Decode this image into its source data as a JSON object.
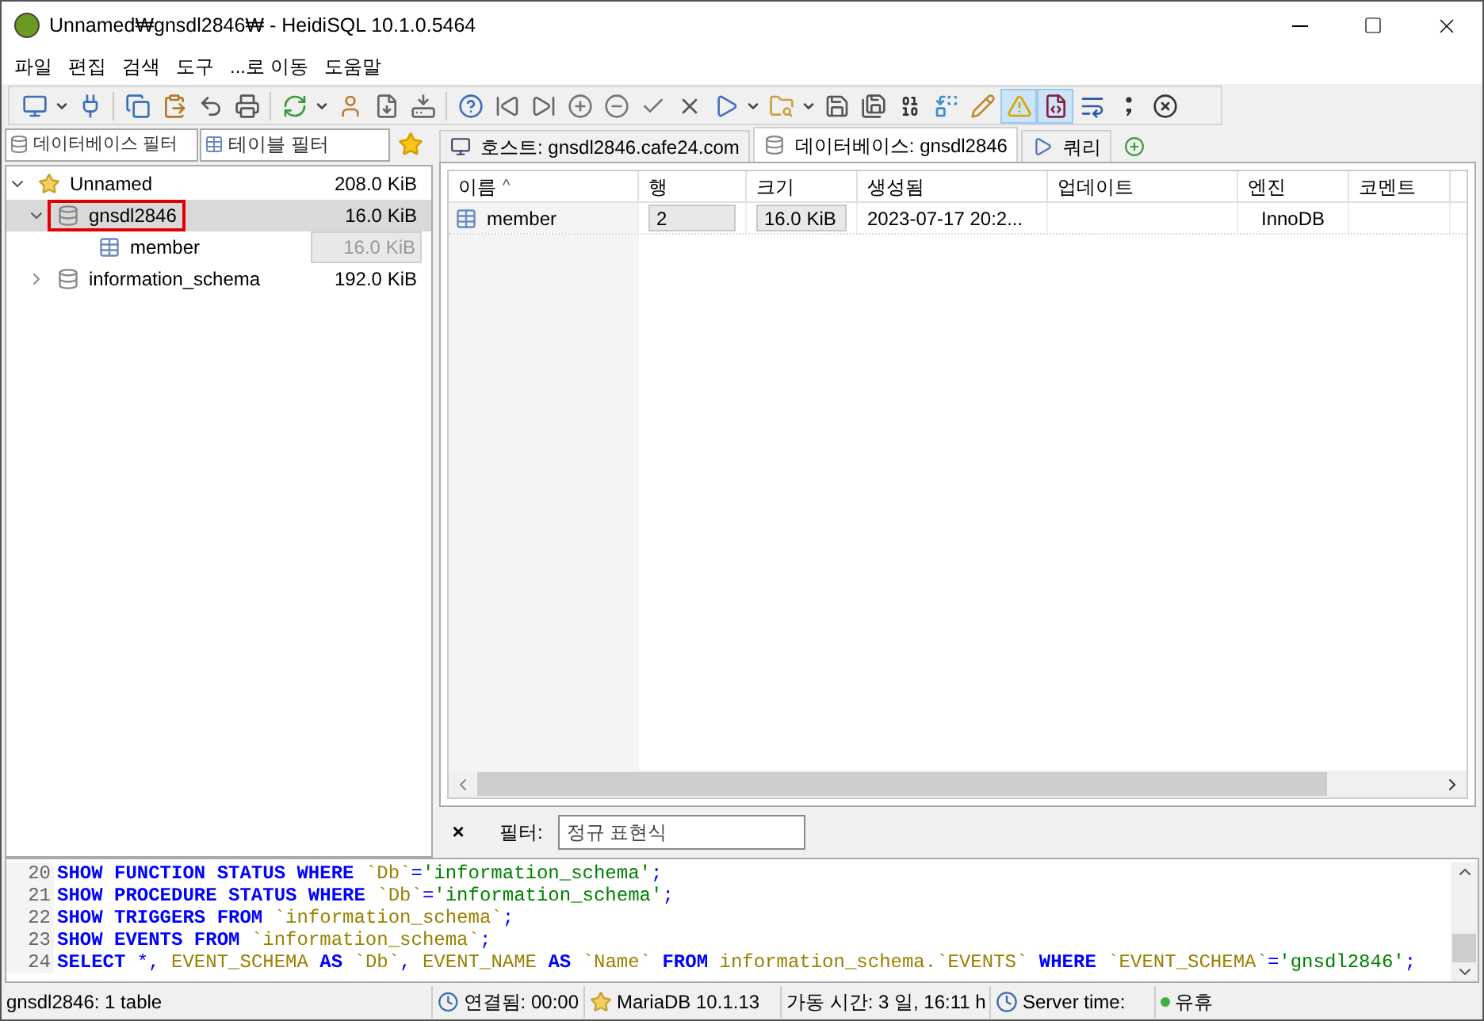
{
  "window": {
    "title": "Unnamed₩gnsdl2846₩ - HeidiSQL 10.1.0.5464"
  },
  "menu": [
    "파일",
    "편집",
    "검색",
    "도구",
    "...로 이동",
    "도움말"
  ],
  "toolbar": [
    {
      "pressed": false
    },
    {
      "pressed": false
    },
    {
      "pressed": false
    },
    {
      "pressed": false
    },
    {
      "pressed": false
    },
    {
      "pressed": false
    },
    {
      "pressed": false
    },
    {
      "pressed": false
    },
    {
      "pressed": false
    },
    {
      "pressed": false
    },
    {
      "pressed": false
    },
    {
      "pressed": false
    },
    {
      "pressed": false
    },
    {
      "pressed": false
    },
    {
      "pressed": false
    },
    {
      "pressed": false
    },
    {
      "pressed": false
    },
    {
      "pressed": false
    },
    {
      "pressed": false
    },
    {
      "pressed": false
    },
    {
      "pressed": false
    },
    {
      "pressed": false
    },
    {
      "pressed": false
    },
    {
      "pressed": false
    },
    {
      "pressed": false
    },
    {
      "pressed": false
    },
    {
      "pressed": false
    },
    {
      "pressed": false
    },
    {
      "pressed": true
    },
    {
      "pressed": true
    },
    {
      "pressed": false
    },
    {
      "pressed": false
    },
    {
      "pressed": false
    }
  ],
  "sidebar": {
    "db_filter": {
      "placeholder": "데이터베이스 필터"
    },
    "table_filter": {
      "placeholder": "테이블 필터"
    },
    "tree": [
      {
        "label": "Unnamed",
        "size": "208.0 KiB",
        "kind": "server",
        "expanded": true,
        "selected": false,
        "annotated": false,
        "children": [
          {
            "label": "gnsdl2846",
            "size": "16.0 KiB",
            "kind": "database",
            "expanded": true,
            "selected": true,
            "annotated": true,
            "children": [
              {
                "label": "member",
                "size": "16.0 KiB",
                "kind": "table",
                "selected": false,
                "annotated": false
              }
            ]
          },
          {
            "label": "information_schema",
            "size": "192.0 KiB",
            "kind": "database",
            "expanded": false,
            "selected": false,
            "annotated": false
          }
        ]
      }
    ]
  },
  "tabs": [
    {
      "label": "호스트: gnsdl2846.cafe24.com",
      "kind": "host",
      "selected": false
    },
    {
      "label": "데이터베이스: gnsdl2846",
      "kind": "database",
      "selected": true
    },
    {
      "label": "쿼리",
      "kind": "query",
      "selected": false
    }
  ],
  "table": {
    "columns": [
      "이름",
      "행",
      "크기",
      "생성됨",
      "업데이트",
      "엔진",
      "코멘트"
    ],
    "sort_mark": "^",
    "rows": [
      [
        "member",
        "2",
        "16.0 KiB",
        "2023-07-17 20:2...",
        "",
        "InnoDB",
        ""
      ]
    ]
  },
  "filter": {
    "close": "×",
    "label": "필터:",
    "placeholder": "정규 표현식"
  },
  "sql_log": [
    {
      "number": "20",
      "tokens": [
        {
          "text": "SHOW FUNCTION STATUS WHERE ",
          "kind": "keyword"
        },
        {
          "text": "`Db`",
          "kind": "identifier"
        },
        {
          "text": "=",
          "kind": "symbol"
        },
        {
          "text": "'information_schema'",
          "kind": "string"
        },
        {
          "text": ";",
          "kind": "symbol"
        }
      ]
    },
    {
      "number": "21",
      "tokens": [
        {
          "text": "SHOW PROCEDURE STATUS WHERE ",
          "kind": "keyword"
        },
        {
          "text": "`Db`",
          "kind": "identifier"
        },
        {
          "text": "=",
          "kind": "symbol"
        },
        {
          "text": "'information_schema'",
          "kind": "string"
        },
        {
          "text": ";",
          "kind": "symbol"
        }
      ]
    },
    {
      "number": "22",
      "tokens": [
        {
          "text": "SHOW TRIGGERS FROM ",
          "kind": "keyword"
        },
        {
          "text": "`information_schema`",
          "kind": "identifier"
        },
        {
          "text": ";",
          "kind": "symbol"
        }
      ]
    },
    {
      "number": "23",
      "tokens": [
        {
          "text": "SHOW EVENTS FROM ",
          "kind": "keyword"
        },
        {
          "text": "`information_schema`",
          "kind": "identifier"
        },
        {
          "text": ";",
          "kind": "symbol"
        }
      ]
    },
    {
      "number": "24",
      "tokens": [
        {
          "text": "SELECT ",
          "kind": "keyword"
        },
        {
          "text": "*, ",
          "kind": "symbol"
        },
        {
          "text": "EVENT_SCHEMA ",
          "kind": "identifier"
        },
        {
          "text": "AS ",
          "kind": "keyword"
        },
        {
          "text": "`Db`",
          "kind": "identifier"
        },
        {
          "text": ", ",
          "kind": "symbol"
        },
        {
          "text": "EVENT_NAME ",
          "kind": "identifier"
        },
        {
          "text": "AS ",
          "kind": "keyword"
        },
        {
          "text": "`Name` ",
          "kind": "identifier"
        },
        {
          "text": "FROM ",
          "kind": "keyword"
        },
        {
          "text": "information_schema.`EVENTS` ",
          "kind": "identifier"
        },
        {
          "text": "WHERE ",
          "kind": "keyword"
        },
        {
          "text": "`EVENT_SCHEMA`",
          "kind": "identifier"
        },
        {
          "text": "=",
          "kind": "symbol"
        },
        {
          "text": "'gnsdl2846'",
          "kind": "string"
        },
        {
          "text": ";",
          "kind": "symbol"
        }
      ]
    }
  ],
  "status_bar": [
    {
      "text": "gnsdl2846: 1 table",
      "kind": "plain"
    },
    {
      "text": "연결됨: 00:00",
      "kind": "clock"
    },
    {
      "text": "MariaDB 10.1.13",
      "kind": "server"
    },
    {
      "text": "가동 시간: 3 일, 16:11 h",
      "kind": "plain"
    },
    {
      "text": "Server time:",
      "kind": "clock"
    },
    {
      "text": "유휴",
      "kind": "idle",
      "color": "#3cb043"
    }
  ]
}
